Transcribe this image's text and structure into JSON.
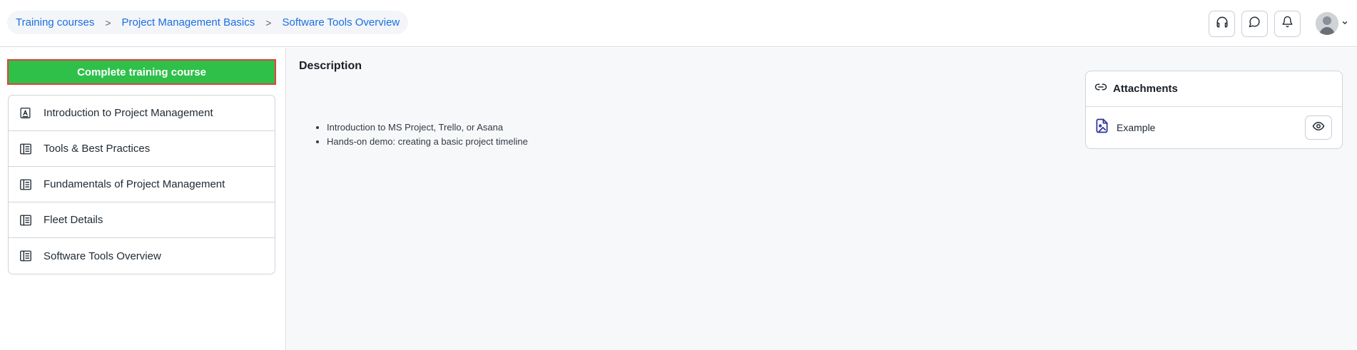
{
  "breadcrumb": [
    {
      "label": "Training courses"
    },
    {
      "label": "Project Management Basics"
    },
    {
      "label": "Software Tools Overview"
    }
  ],
  "breadcrumb_separator": ">",
  "header": {
    "icons": [
      "headset-icon",
      "chat-icon",
      "bell-icon",
      "avatar",
      "chevron-down-icon"
    ]
  },
  "sidebar": {
    "complete_button": "Complete training course",
    "lessons": [
      {
        "label": "Introduction to Project Management",
        "icon": "letter-a-icon"
      },
      {
        "label": "Tools & Best Practices",
        "icon": "document-icon"
      },
      {
        "label": "Fundamentals of Project Management",
        "icon": "document-icon"
      },
      {
        "label": "Fleet Details",
        "icon": "document-icon"
      },
      {
        "label": "Software Tools Overview",
        "icon": "document-icon"
      }
    ]
  },
  "main": {
    "description_title": "Description",
    "description_items": [
      "Introduction to MS Project, Trello, or Asana",
      "Hands-on demo: creating a basic project timeline"
    ],
    "attachments": {
      "title": "Attachments",
      "items": [
        {
          "name": "Example",
          "icon": "image-file-icon",
          "action_icon": "eye-icon"
        }
      ]
    }
  },
  "colors": {
    "accent_link": "#1b6fe0",
    "complete_button_bg": "#2fc04a",
    "complete_button_border": "#e0413e",
    "file_icon": "#2a2f9e"
  }
}
